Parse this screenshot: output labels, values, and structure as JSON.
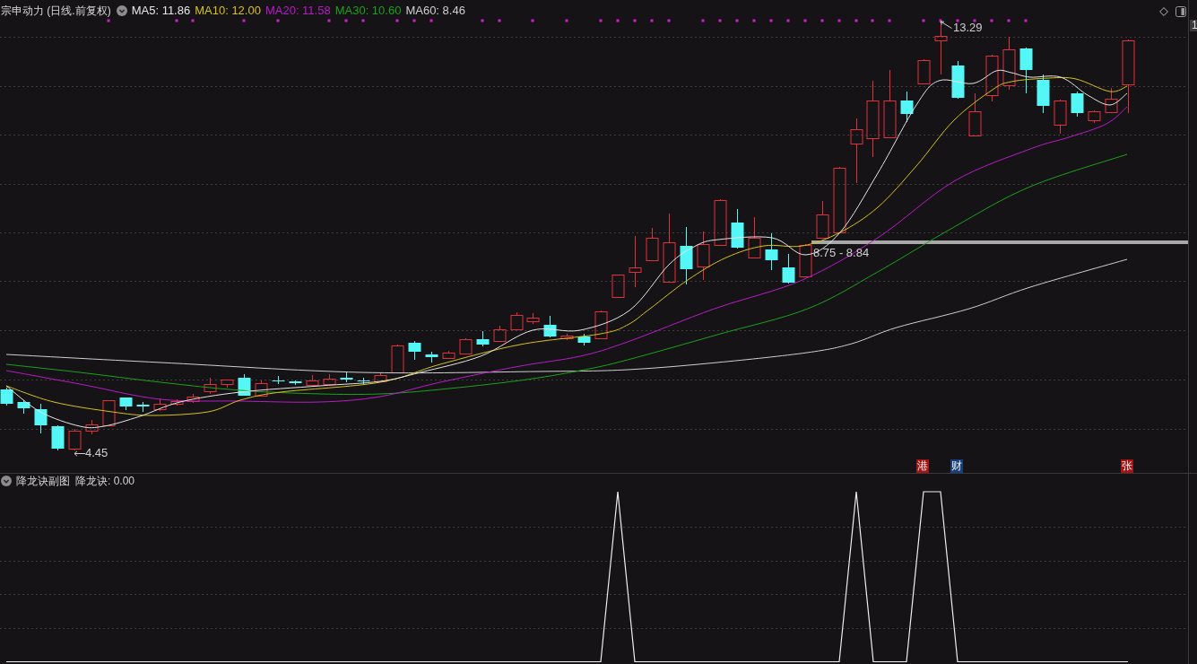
{
  "header": {
    "title": "宗申动力 (日线.前复权)",
    "indicators": [
      {
        "label": "MA5: 11.86",
        "color": "#e6e6e6"
      },
      {
        "label": "MA10: 12.00",
        "color": "#d6c21c"
      },
      {
        "label": "MA20: 11.58",
        "color": "#b81cc8"
      },
      {
        "label": "MA30: 10.60",
        "color": "#1aa31a"
      },
      {
        "label": "MA60: 8.46",
        "color": "#cfcfcf"
      }
    ]
  },
  "price_axis": {
    "label": "1"
  },
  "main_chart": {
    "high_label": "13.29",
    "low_label": "4.45",
    "zone_label": "8.75 - 8.84",
    "markers": [
      {
        "text": "港",
        "color": "#a31515"
      },
      {
        "text": "财",
        "color": "#173f78"
      },
      {
        "text": "张",
        "color": "#a31515"
      }
    ]
  },
  "sub_chart": {
    "title": "降龙诀副图",
    "value": "降龙诀: 0.00"
  }
}
